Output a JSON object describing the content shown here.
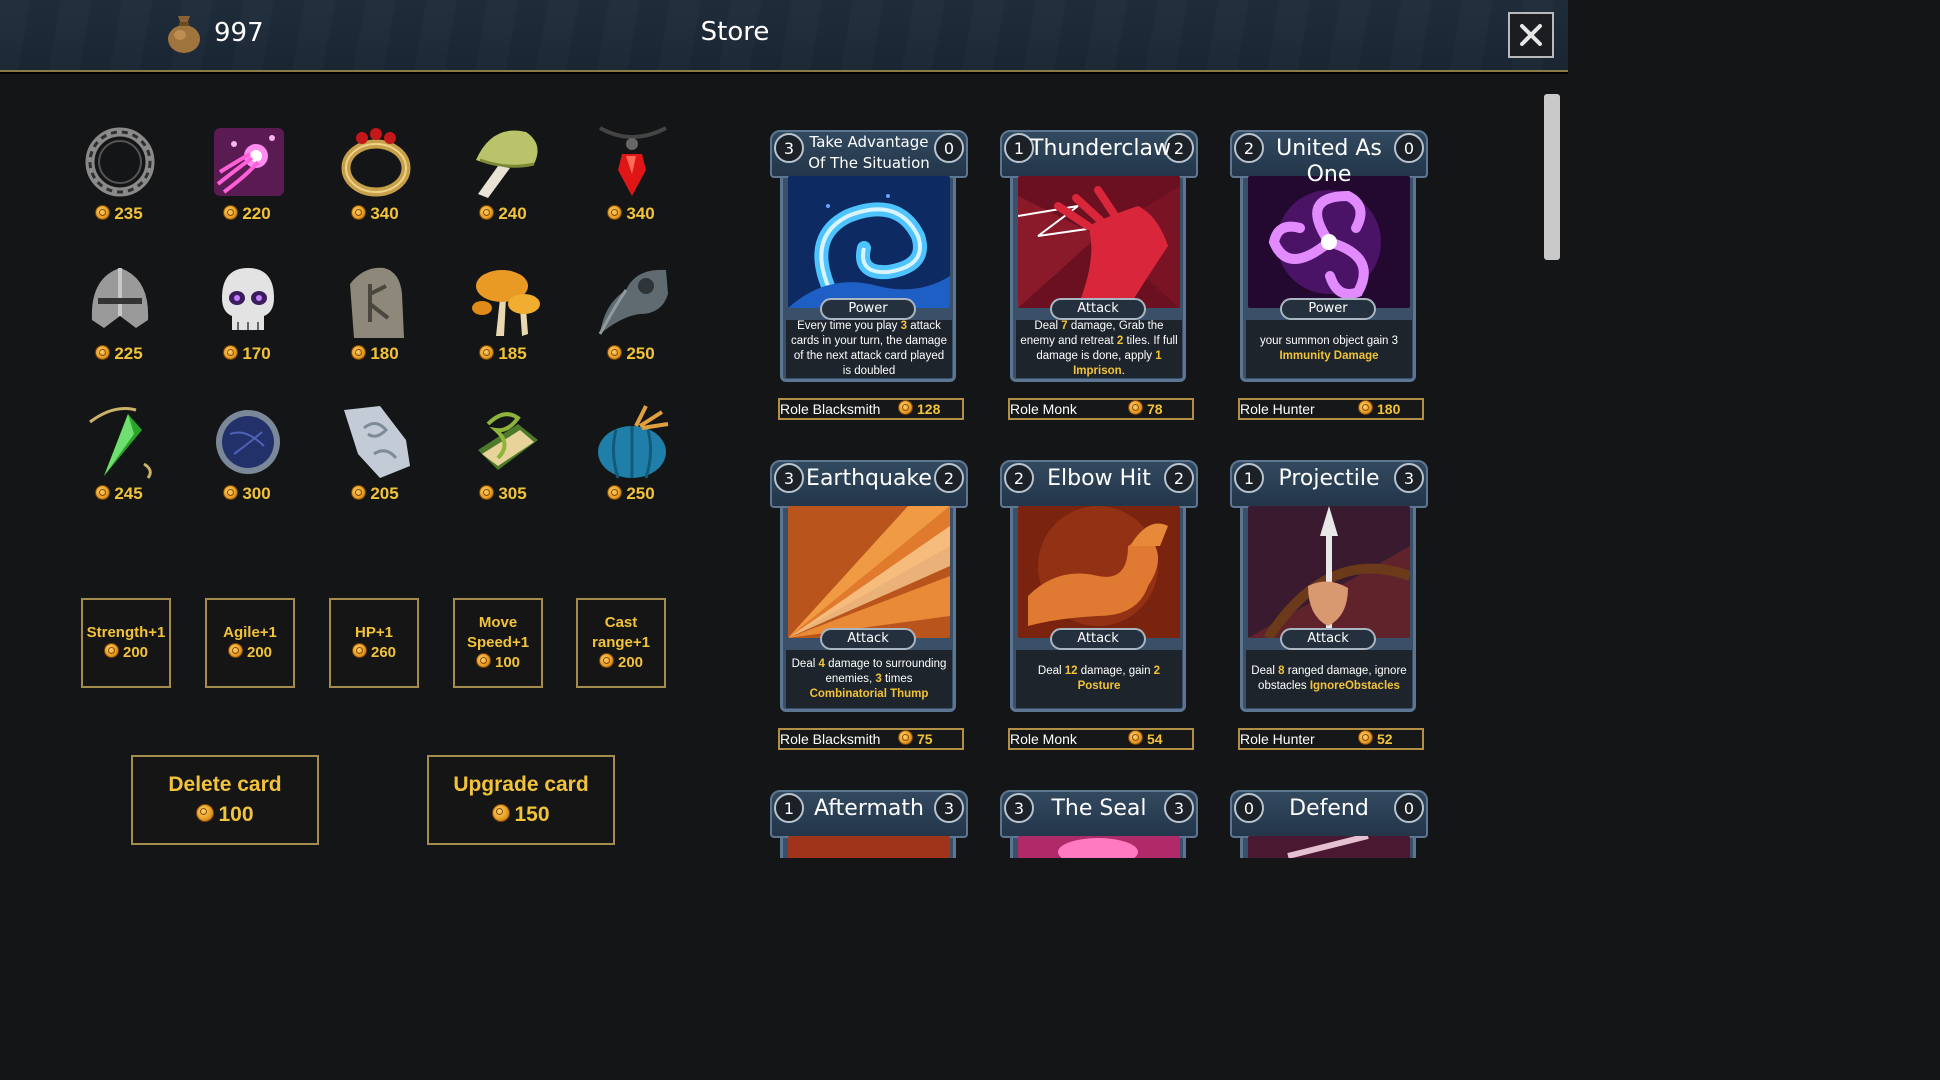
{
  "header": {
    "currency_value": "997",
    "title": "Store",
    "close_icon": "close-icon"
  },
  "items": [
    {
      "name": "ring-dark",
      "price": "235"
    },
    {
      "name": "magic-wisp",
      "price": "220"
    },
    {
      "name": "gold-ruby-ring",
      "price": "340"
    },
    {
      "name": "pale-mushroom",
      "price": "240"
    },
    {
      "name": "red-gem-amulet",
      "price": "340"
    },
    {
      "name": "iron-helmet",
      "price": "225"
    },
    {
      "name": "skull",
      "price": "170"
    },
    {
      "name": "rune-stone",
      "price": "180"
    },
    {
      "name": "orange-mushrooms",
      "price": "185"
    },
    {
      "name": "plague-mask",
      "price": "250"
    },
    {
      "name": "green-crystal-pendulum",
      "price": "245"
    },
    {
      "name": "blue-orb-disc",
      "price": "300"
    },
    {
      "name": "silver-bracer",
      "price": "205"
    },
    {
      "name": "vine-book",
      "price": "305"
    },
    {
      "name": "blue-pumpkin",
      "price": "250"
    }
  ],
  "stats": [
    {
      "lines": [
        "Strength+1"
      ],
      "price": "200"
    },
    {
      "lines": [
        "Agile+1"
      ],
      "price": "200"
    },
    {
      "lines": [
        "HP+1"
      ],
      "price": "260"
    },
    {
      "lines": [
        "Move",
        "Speed+1"
      ],
      "price": "100"
    },
    {
      "lines": [
        "Cast",
        "range+1"
      ],
      "price": "200"
    }
  ],
  "actions": {
    "delete": {
      "label": "Delete card",
      "price": "100"
    },
    "upgrade": {
      "label": "Upgrade card",
      "price": "150"
    }
  },
  "cards": [
    {
      "cost": "3",
      "count": "0",
      "name": "Take Advantage Of The Situation",
      "type": "Power",
      "desc": [
        [
          "Every time you play ",
          ""
        ],
        [
          "3",
          "hl"
        ],
        [
          " attack cards in your turn, the damage of the next attack card played is doubled",
          ""
        ]
      ],
      "role": "Role Blacksmith",
      "price": "128"
    },
    {
      "cost": "1",
      "count": "2",
      "name": "Thunderclaw",
      "type": "Attack",
      "desc": [
        [
          "Deal ",
          ""
        ],
        [
          "7",
          "hl"
        ],
        [
          " damage, Grab the enemy and retreat ",
          ""
        ],
        [
          "2",
          "hl"
        ],
        [
          " tiles. If full damage is done, apply ",
          ""
        ],
        [
          "1 Imprison",
          "hl"
        ],
        [
          ".",
          ""
        ]
      ],
      "role": "Role Monk",
      "price": "78"
    },
    {
      "cost": "2",
      "count": "0",
      "name": "United As One",
      "type": "Power",
      "desc": [
        [
          "your summon object gain 3 ",
          ""
        ],
        [
          "Immunity Damage",
          "hl"
        ]
      ],
      "role": "Role Hunter",
      "price": "180"
    },
    {
      "cost": "3",
      "count": "2",
      "name": "Earthquake",
      "type": "Attack",
      "desc": [
        [
          "Deal ",
          ""
        ],
        [
          "4",
          "hl"
        ],
        [
          " damage to surrounding enemies, ",
          ""
        ],
        [
          "3",
          "hl"
        ],
        [
          " times ",
          ""
        ],
        [
          "Combinatorial Thump",
          "hl"
        ]
      ],
      "role": "Role Blacksmith",
      "price": "75"
    },
    {
      "cost": "2",
      "count": "2",
      "name": "Elbow Hit",
      "type": "Attack",
      "desc": [
        [
          "Deal ",
          ""
        ],
        [
          "12",
          "hl"
        ],
        [
          " damage, gain ",
          ""
        ],
        [
          "2 Posture",
          "hl"
        ]
      ],
      "role": "Role Monk",
      "price": "54"
    },
    {
      "cost": "1",
      "count": "3",
      "name": "Projectile",
      "type": "Attack",
      "desc": [
        [
          "Deal ",
          ""
        ],
        [
          "8",
          "hl"
        ],
        [
          " ranged damage, ignore obstacles ",
          ""
        ],
        [
          "IgnoreObstacles",
          "hl"
        ]
      ],
      "role": "Role Hunter",
      "price": "52"
    },
    {
      "cost": "1",
      "count": "3",
      "name": "Aftermath"
    },
    {
      "cost": "3",
      "count": "3",
      "name": "The Seal"
    },
    {
      "cost": "0",
      "count": "0",
      "name": "Defend"
    }
  ],
  "colors": {
    "gold_text": "#f2c33a",
    "card_frame": "#3a5068",
    "background": "#141516"
  }
}
